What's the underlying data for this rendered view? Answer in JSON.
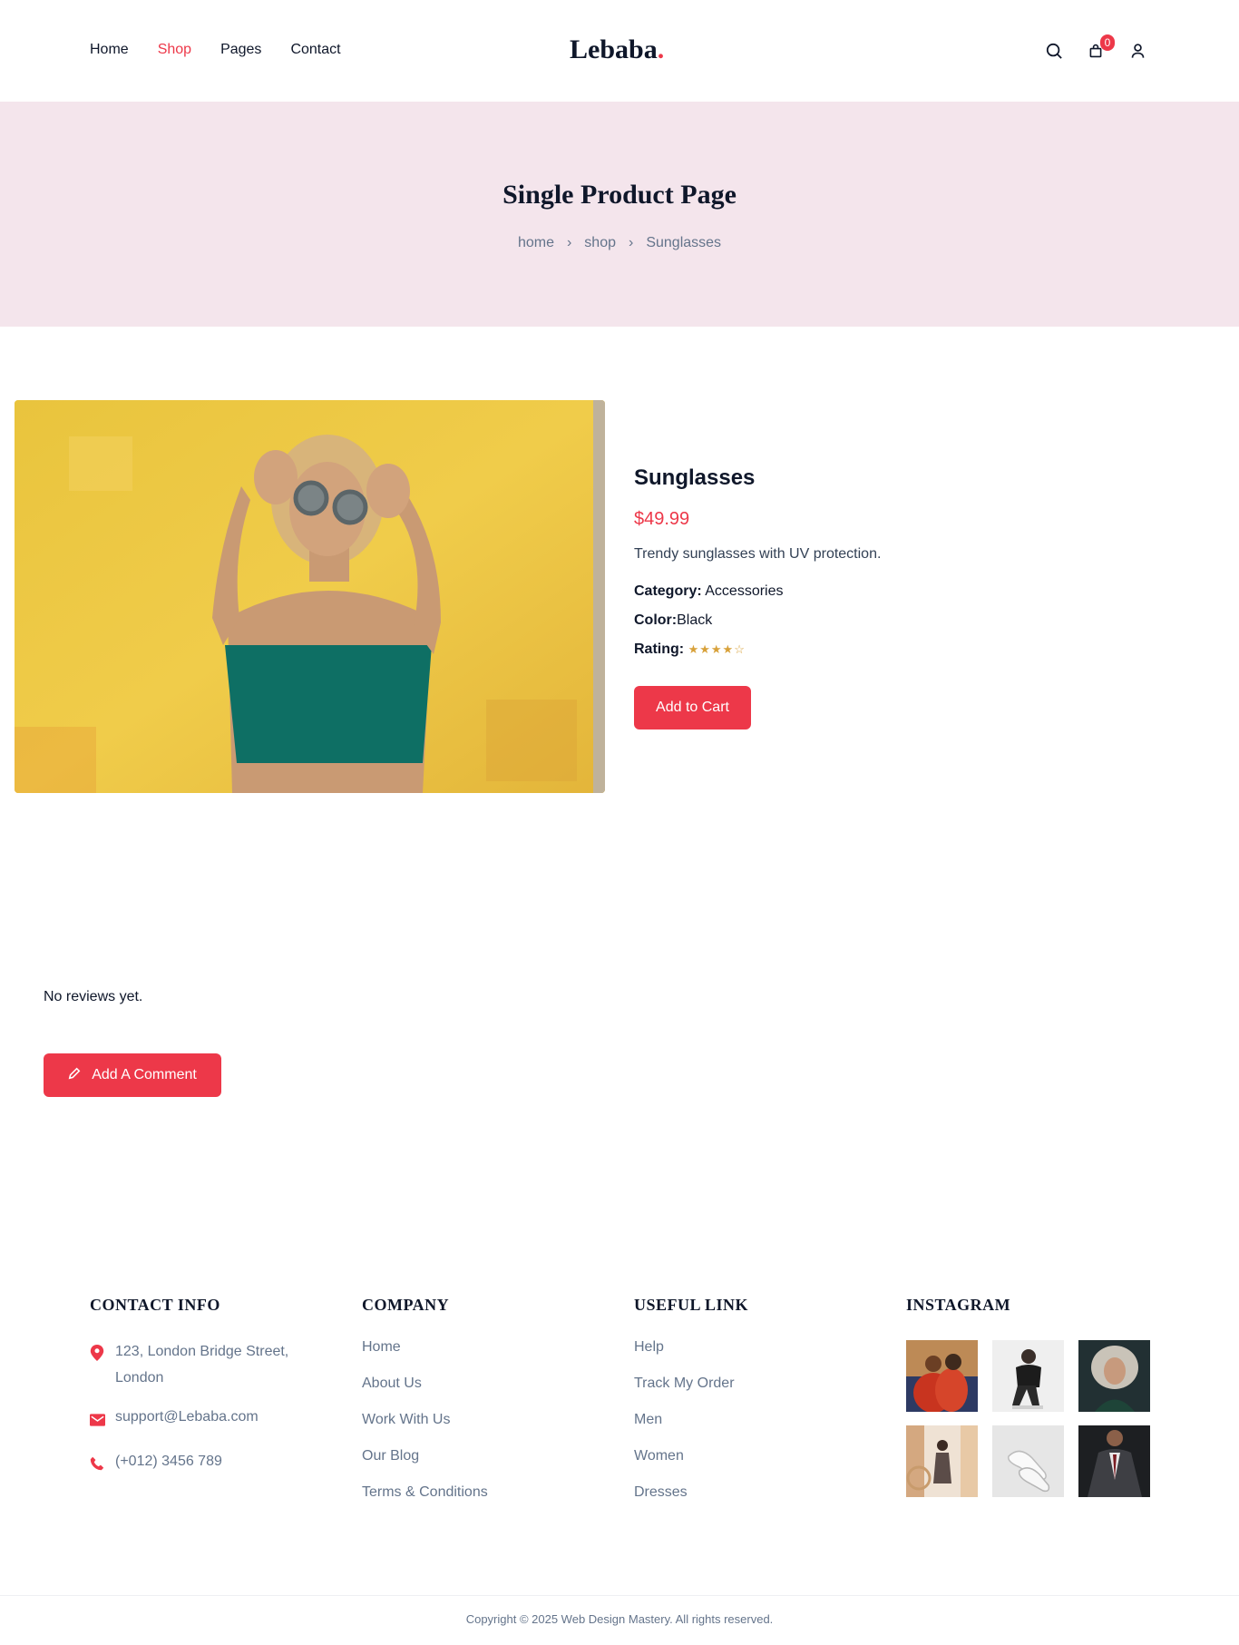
{
  "header": {
    "nav": [
      {
        "label": "Home"
      },
      {
        "label": "Shop"
      },
      {
        "label": "Pages"
      },
      {
        "label": "Contact"
      }
    ],
    "logo": "Lebaba",
    "logo_dot": ".",
    "cart_count": "0",
    "icons": [
      "search-icon",
      "shopping-bag-icon",
      "user-icon"
    ]
  },
  "hero": {
    "title": "Single Product Page",
    "breadcrumb": [
      "home",
      "shop",
      "Sunglasses"
    ]
  },
  "product": {
    "name": "Sunglasses",
    "price": "$49.99",
    "description": "Trendy sunglasses with UV protection.",
    "category_label": "Category:",
    "category": "Accessories",
    "color_label": "Color:",
    "color": "Black",
    "rating_label": "Rating:",
    "rating": 4,
    "rating_max": 5,
    "add_to_cart": "Add to Cart"
  },
  "reviews": {
    "empty_text": "No reviews yet.",
    "add_comment": "Add A Comment"
  },
  "footer": {
    "contact": {
      "title": "CONTACT INFO",
      "address": "123, London Bridge Street, London",
      "email": "support@Lebaba.com",
      "phone": "(+012) 3456 789"
    },
    "company": {
      "title": "COMPANY",
      "links": [
        "Home",
        "About Us",
        "Work With Us",
        "Our Blog",
        "Terms & Conditions"
      ]
    },
    "useful": {
      "title": "USEFUL LINK",
      "links": [
        "Help",
        "Track My Order",
        "Men",
        "Women",
        "Dresses"
      ]
    },
    "instagram": {
      "title": "INSTAGRAM"
    },
    "copyright": "Copyright © 2025 Web Design Mastery. All rights reserved."
  },
  "colors": {
    "accent": "#ed3849",
    "hero_bg": "#f4e5ec",
    "text": "#0f172a",
    "muted": "#64748b",
    "star": "#d8a13a"
  }
}
